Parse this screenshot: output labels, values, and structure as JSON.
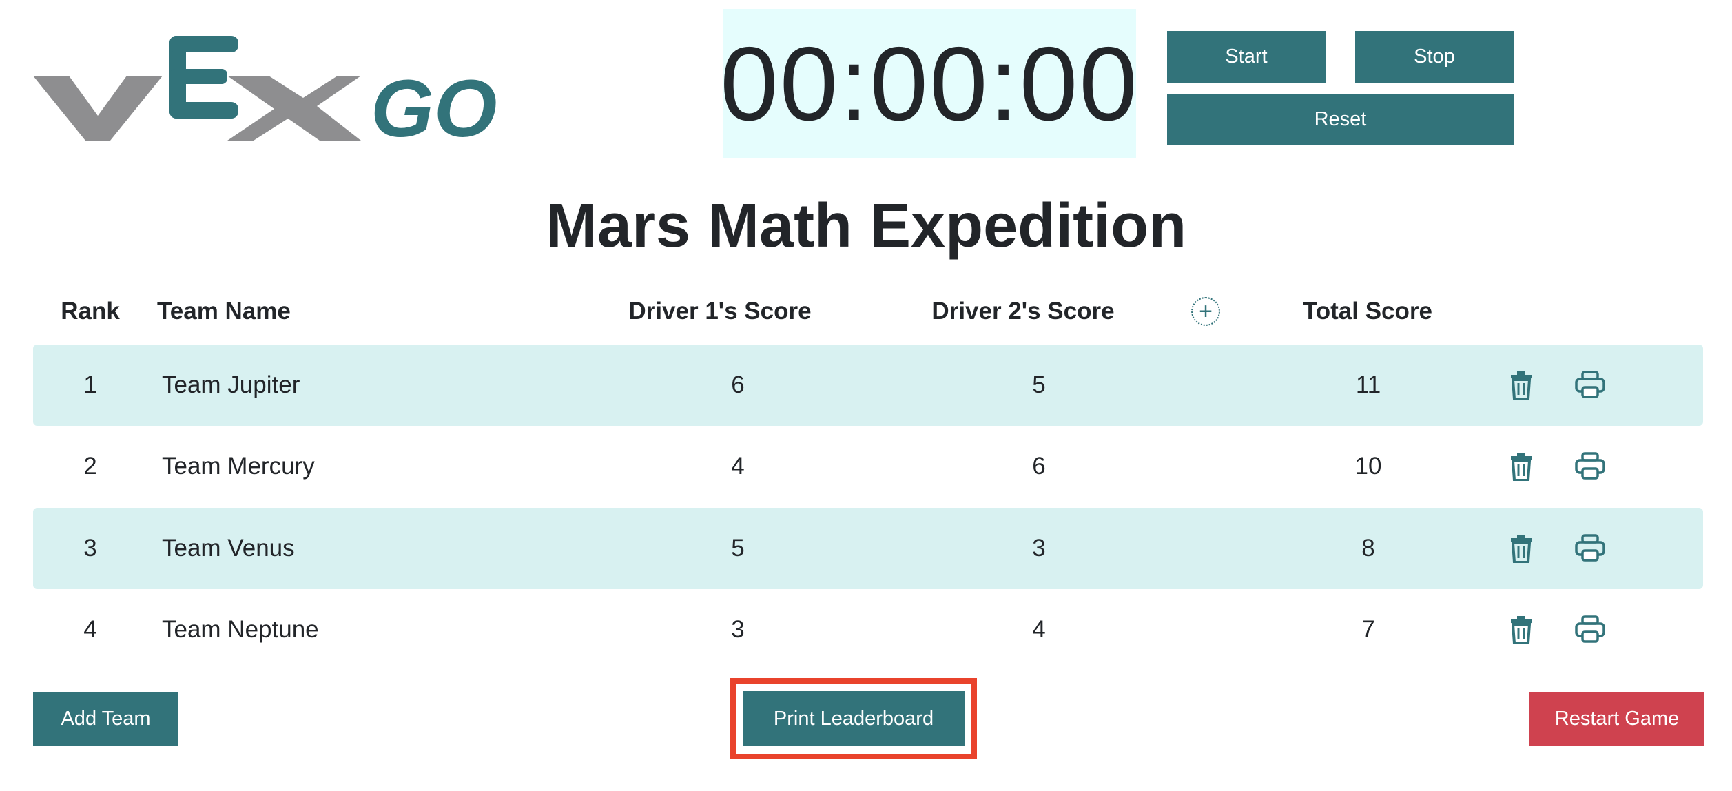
{
  "logo": {
    "text_vex": "VEX",
    "text_go": "GO"
  },
  "timer": {
    "display": "00:00:00"
  },
  "controls": {
    "start_label": "Start",
    "stop_label": "Stop",
    "reset_label": "Reset"
  },
  "page": {
    "title": "Mars Math Expedition"
  },
  "table": {
    "headers": {
      "rank": "Rank",
      "team_name": "Team Name",
      "driver1": "Driver 1's Score",
      "driver2": "Driver 2's Score",
      "total": "Total Score"
    },
    "add_column_icon": "plus-circle-icon",
    "rows": [
      {
        "rank": "1",
        "team": "Team Jupiter",
        "driver1": "6",
        "driver2": "5",
        "total": "11"
      },
      {
        "rank": "2",
        "team": "Team Mercury",
        "driver1": "4",
        "driver2": "6",
        "total": "10"
      },
      {
        "rank": "3",
        "team": "Team Venus",
        "driver1": "5",
        "driver2": "3",
        "total": "8"
      },
      {
        "rank": "4",
        "team": "Team Neptune",
        "driver1": "3",
        "driver2": "4",
        "total": "7"
      }
    ],
    "row_icons": [
      "trash-icon",
      "printer-icon"
    ]
  },
  "footer": {
    "add_team_label": "Add Team",
    "print_leaderboard_label": "Print Leaderboard",
    "restart_label": "Restart Game"
  },
  "colors": {
    "accent": "#32737a",
    "row_shade": "#d8f1f1",
    "timer_bg": "#e5fdfd",
    "danger": "#cf424f",
    "highlight": "#e9432c",
    "logo_gray": "#8e8e90"
  }
}
